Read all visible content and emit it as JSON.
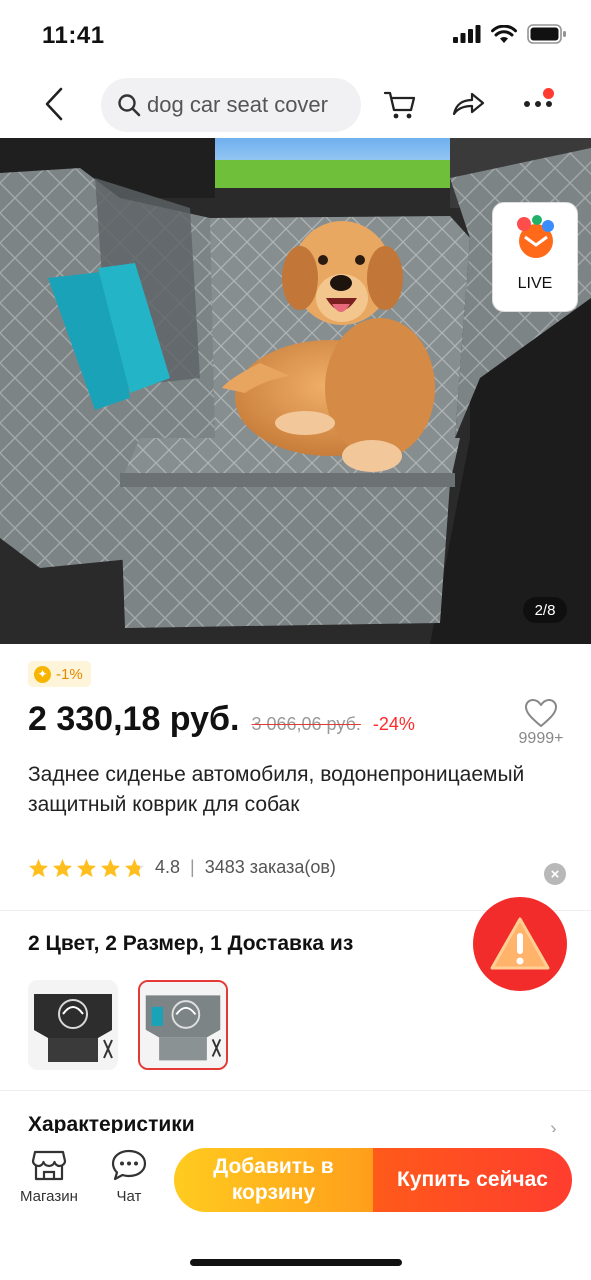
{
  "status_bar": {
    "time": "11:41"
  },
  "search": {
    "query": "dog car seat cover"
  },
  "nav": {
    "icons": [
      "back-arrow-icon",
      "search-icon",
      "cart-icon",
      "share-icon",
      "more-icon"
    ]
  },
  "gallery": {
    "live_label": "LIVE",
    "counter": "2/8"
  },
  "coin_badge": {
    "text": "-1%"
  },
  "price": {
    "current": "2 330,18 руб.",
    "old": "3 066,06 руб.",
    "discount": "-24%"
  },
  "wishlist": {
    "count": "9999+"
  },
  "product": {
    "title": "Заднее сиденье автомобиля, водонепроницаемый защитный коврик для собак",
    "rating": "4.8",
    "orders": "3483 заказа(ов)",
    "rating_stars": 4.8
  },
  "variants": {
    "title": "2 Цвет, 2 Размер, 1 Доставка из"
  },
  "specs": {
    "title": "Характеристики"
  },
  "bottom_bar": {
    "store_label": "Магазин",
    "chat_label": "Чат",
    "add_to_cart": "Добавить в корзину",
    "buy_now": "Купить сейчас"
  },
  "colors": {
    "accent": "#ff3d2e",
    "add_cart": "#ffb21d",
    "discount": "#ff2a2a",
    "coin": "#f7b500"
  }
}
